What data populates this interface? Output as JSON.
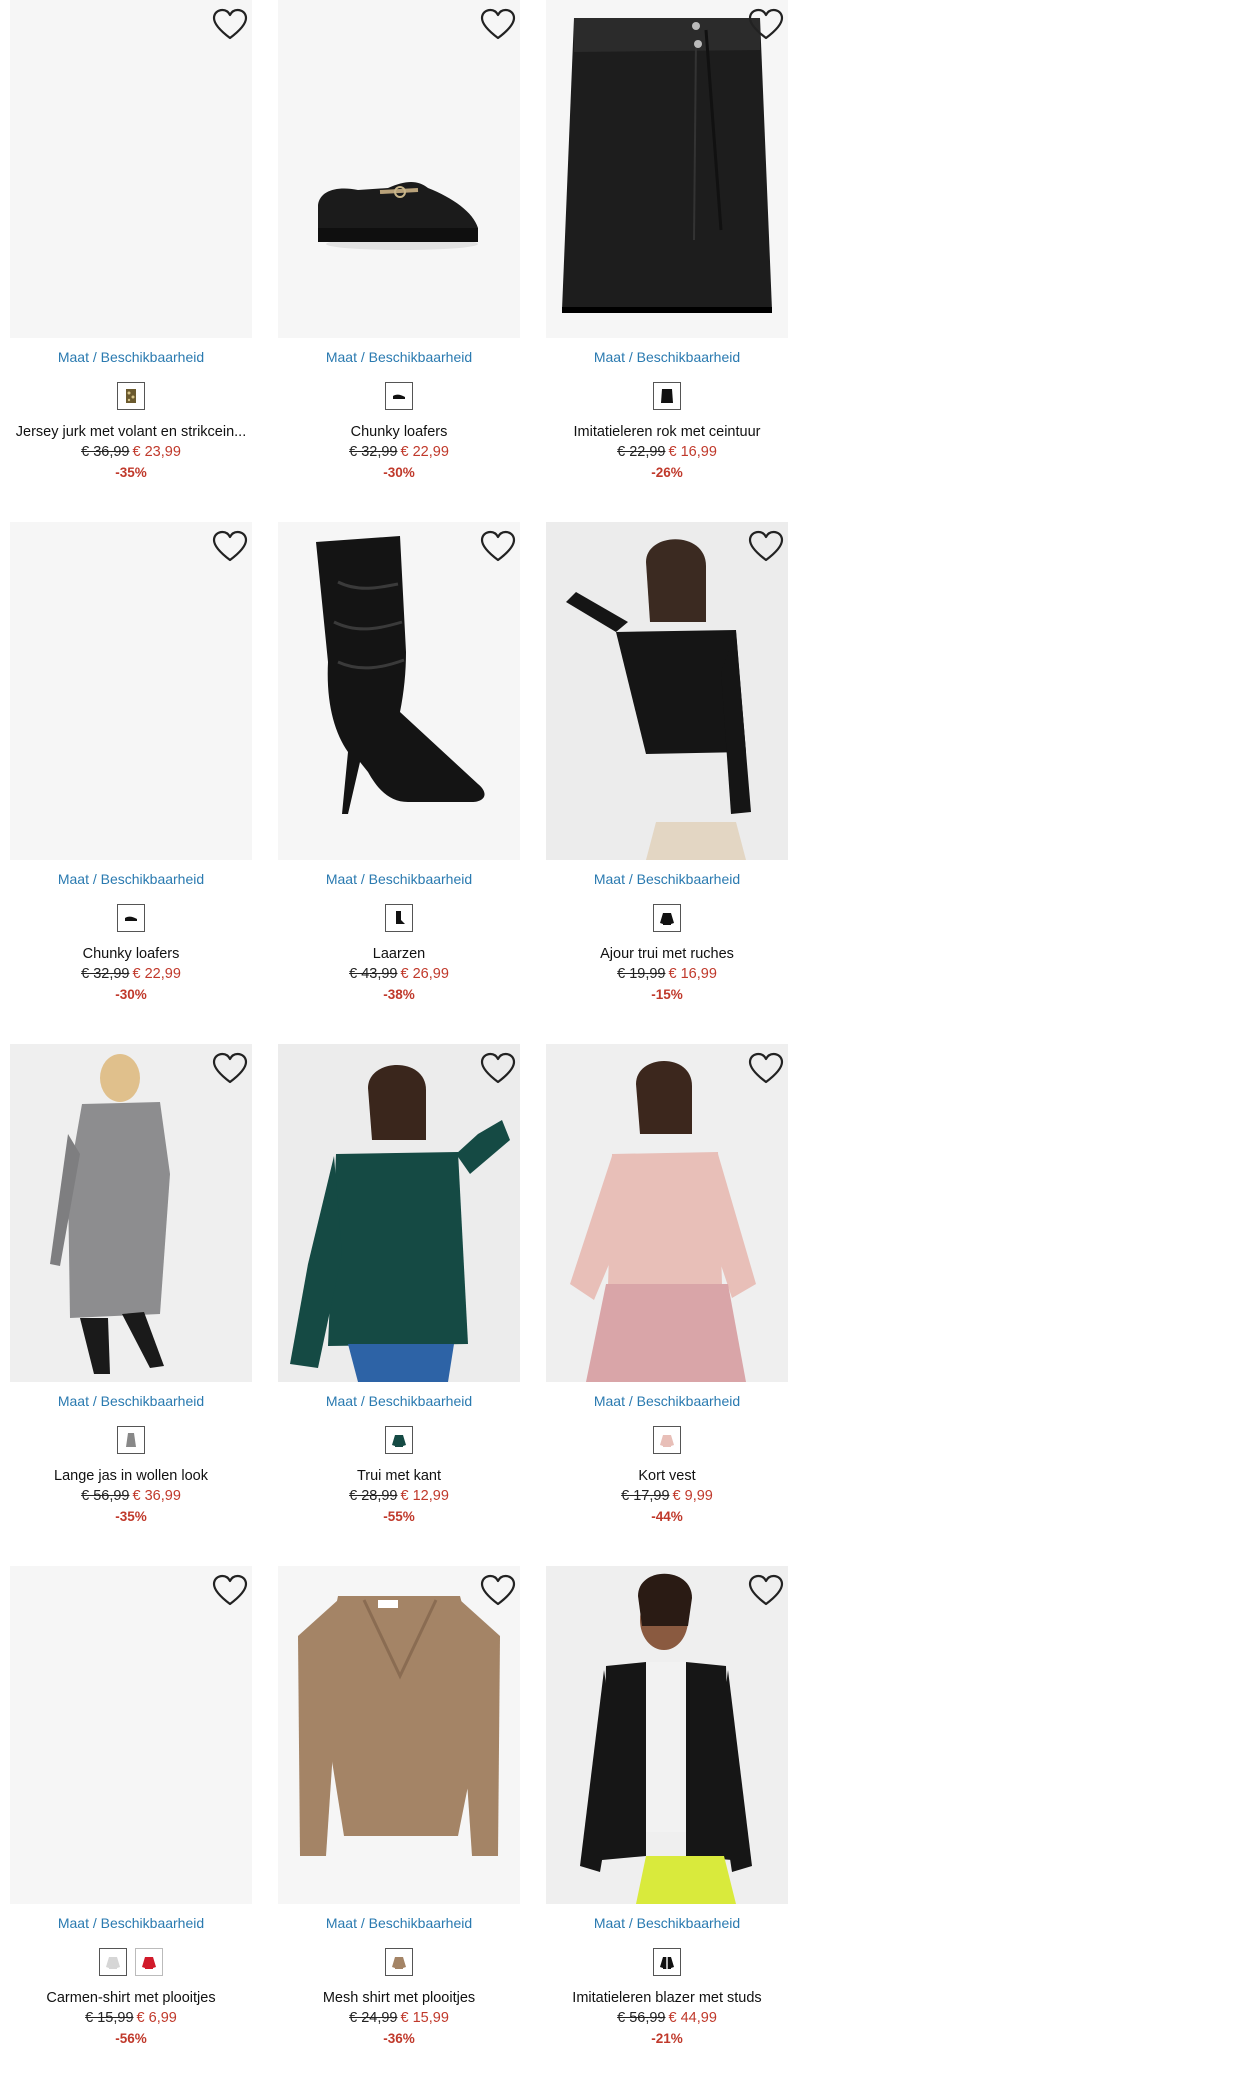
{
  "colors": {
    "link": "#2a7ab0",
    "sale": "#c0392b",
    "tile_bg": "#f6f6f6"
  },
  "size_label": "Maat / Beschikbaarheid",
  "products": [
    {
      "name": "Jersey jurk met volant en strikcein...",
      "old_price": "€ 36,99",
      "new_price": "€ 23,99",
      "discount": "-35%",
      "image": "blank",
      "swatches": [
        "print-dress"
      ]
    },
    {
      "name": "Chunky loafers",
      "old_price": "€ 32,99",
      "new_price": "€ 22,99",
      "discount": "-30%",
      "image": "loafer",
      "swatches": [
        "black-loafer"
      ]
    },
    {
      "name": "Imitatieleren rok met ceintuur",
      "old_price": "€ 22,99",
      "new_price": "€ 16,99",
      "discount": "-26%",
      "image": "skirt",
      "swatches": [
        "black-skirt"
      ]
    },
    {
      "name": "Chunky loafers",
      "old_price": "€ 32,99",
      "new_price": "€ 22,99",
      "discount": "-30%",
      "image": "blank",
      "swatches": [
        "black-loafer"
      ]
    },
    {
      "name": "Laarzen",
      "old_price": "€ 43,99",
      "new_price": "€ 26,99",
      "discount": "-38%",
      "image": "boot",
      "swatches": [
        "black-boot"
      ]
    },
    {
      "name": "Ajour trui met ruches",
      "old_price": "€ 19,99",
      "new_price": "€ 16,99",
      "discount": "-15%",
      "image": "black-sweater",
      "swatches": [
        "black-top"
      ]
    },
    {
      "name": "Lange jas in wollen look",
      "old_price": "€ 56,99",
      "new_price": "€ 36,99",
      "discount": "-35%",
      "image": "grey-coat",
      "swatches": [
        "grey-coat"
      ]
    },
    {
      "name": "Trui met kant",
      "old_price": "€ 28,99",
      "new_price": "€ 12,99",
      "discount": "-55%",
      "image": "green-sweater",
      "swatches": [
        "green-top"
      ]
    },
    {
      "name": "Kort vest",
      "old_price": "€ 17,99",
      "new_price": "€ 9,99",
      "discount": "-44%",
      "image": "pink-cardigan",
      "swatches": [
        "pink-top"
      ]
    },
    {
      "name": "Carmen-shirt met plooitjes",
      "old_price": "€ 15,99",
      "new_price": "€ 6,99",
      "discount": "-56%",
      "image": "blank",
      "swatches": [
        "white-top",
        "red-top"
      ]
    },
    {
      "name": "Mesh shirt met plooitjes",
      "old_price": "€ 24,99",
      "new_price": "€ 15,99",
      "discount": "-36%",
      "image": "beige-top",
      "swatches": [
        "beige-top"
      ]
    },
    {
      "name": "Imitatieleren blazer met studs",
      "old_price": "€ 56,99",
      "new_price": "€ 44,99",
      "discount": "-21%",
      "image": "leather-jacket",
      "swatches": [
        "black-jacket"
      ]
    }
  ]
}
